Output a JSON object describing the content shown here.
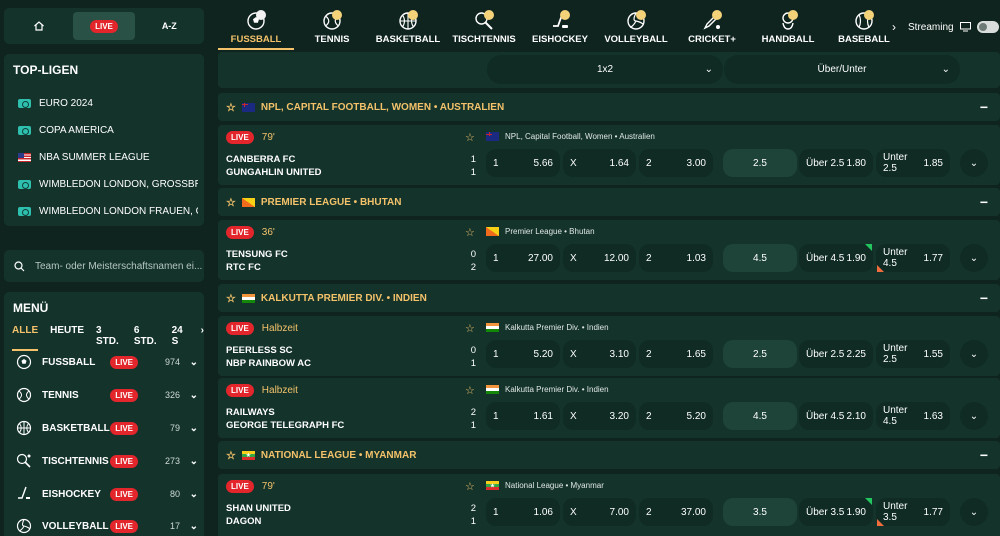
{
  "topnav": {
    "live": "LIVE",
    "az": "A-Z"
  },
  "top_leagues": {
    "title": "TOP-LIGEN",
    "items": [
      {
        "label": "EURO 2024",
        "icon": "league-icon"
      },
      {
        "label": "COPA AMERICA",
        "icon": "league-icon"
      },
      {
        "label": "NBA SUMMER LEAGUE",
        "icon": "us-flag-icon"
      },
      {
        "label": "WIMBLEDON LONDON, GROSSBRI...",
        "icon": "league-icon"
      },
      {
        "label": "WIMBLEDON LONDON FRAUEN, G...",
        "icon": "league-icon"
      }
    ]
  },
  "search": {
    "placeholder": "Team- oder Meisterschaftsnamen ei..."
  },
  "menu": {
    "title": "MENÜ",
    "tabs": [
      "ALLE",
      "HEUTE",
      "3 STD.",
      "6 STD.",
      "24 S"
    ],
    "sports": [
      {
        "name": "FUSSBALL",
        "count": "974",
        "icon": "soccer-ball-icon"
      },
      {
        "name": "TENNIS",
        "count": "326",
        "icon": "tennis-ball-icon"
      },
      {
        "name": "BASKETBALL",
        "count": "79",
        "icon": "basketball-icon"
      },
      {
        "name": "TISCHTENNIS",
        "count": "273",
        "icon": "table-tennis-icon"
      },
      {
        "name": "EISHOCKEY",
        "count": "80",
        "icon": "hockey-icon"
      },
      {
        "name": "VOLLEYBALL",
        "count": "17",
        "icon": "volleyball-icon"
      }
    ]
  },
  "live_label": "LIVE",
  "sports_tabs": [
    "FUSSBALL",
    "TENNIS",
    "BASKETBALL",
    "TISCHTENNIS",
    "EISHOCKEY",
    "VOLLEYBALL",
    "CRICKET+",
    "HANDBALL",
    "BASEBALL"
  ],
  "streaming": {
    "label": "Streaming"
  },
  "market": {
    "select1": "1x2",
    "select2": "Über/Unter"
  },
  "leagues": [
    {
      "name": "NPL, CAPITAL FOOTBALL, WOMEN • AUSTRALIEN",
      "flag": "au",
      "matches": [
        {
          "status": "79'",
          "info": "NPL, Capital Football, Women • Australien",
          "home": "CANBERRA FC",
          "away": "GUNGAHLIN UNITED",
          "home_score": "1",
          "away_score": "1",
          "o1": "5.66",
          "ox": "1.64",
          "o2": "3.00",
          "line": "2.5",
          "over_label": "Über 2.5",
          "over": "1.80",
          "under_label": "Unter 2.5",
          "under": "1.85"
        }
      ]
    },
    {
      "name": "PREMIER LEAGUE • BHUTAN",
      "flag": "bt",
      "matches": [
        {
          "status": "36'",
          "info": "Premier League • Bhutan",
          "home": "TENSUNG FC",
          "away": "RTC FC",
          "home_score": "0",
          "away_score": "2",
          "o1": "27.00",
          "ox": "12.00",
          "o2": "1.03",
          "line": "4.5",
          "over_label": "Über 4.5",
          "over": "1.90",
          "under_label": "Unter 4.5",
          "under": "1.77"
        }
      ]
    },
    {
      "name": "KALKUTTA PREMIER DIV. • INDIEN",
      "flag": "in",
      "matches": [
        {
          "status": "Halbzeit",
          "info": "Kalkutta Premier Div. • Indien",
          "home": "PEERLESS SC",
          "away": "NBP RAINBOW AC",
          "home_score": "0",
          "away_score": "1",
          "o1": "5.20",
          "ox": "3.10",
          "o2": "1.65",
          "line": "2.5",
          "over_label": "Über 2.5",
          "over": "2.25",
          "under_label": "Unter 2.5",
          "under": "1.55"
        },
        {
          "status": "Halbzeit",
          "info": "Kalkutta Premier Div. • Indien",
          "home": "RAILWAYS",
          "away": "GEORGE TELEGRAPH FC",
          "home_score": "2",
          "away_score": "1",
          "o1": "1.61",
          "ox": "3.20",
          "o2": "5.20",
          "line": "4.5",
          "over_label": "Über 4.5",
          "over": "2.10",
          "under_label": "Unter 4.5",
          "under": "1.63"
        }
      ]
    },
    {
      "name": "NATIONAL LEAGUE • MYANMAR",
      "flag": "mm",
      "matches": [
        {
          "status": "79'",
          "info": "National League • Myanmar",
          "home": "SHAN UNITED",
          "away": "DAGON",
          "home_score": "2",
          "away_score": "1",
          "o1": "1.06",
          "ox": "7.00",
          "o2": "37.00",
          "line": "3.5",
          "over_label": "Über 3.5",
          "over": "1.90",
          "under_label": "Unter 3.5",
          "under": "1.77"
        }
      ]
    }
  ],
  "odds_labels": {
    "home": "1",
    "draw": "X",
    "away": "2"
  },
  "colors": {
    "accent": "#f3c26a",
    "live": "#e2262b",
    "panel": "#14332b",
    "background": "#0f241e"
  }
}
